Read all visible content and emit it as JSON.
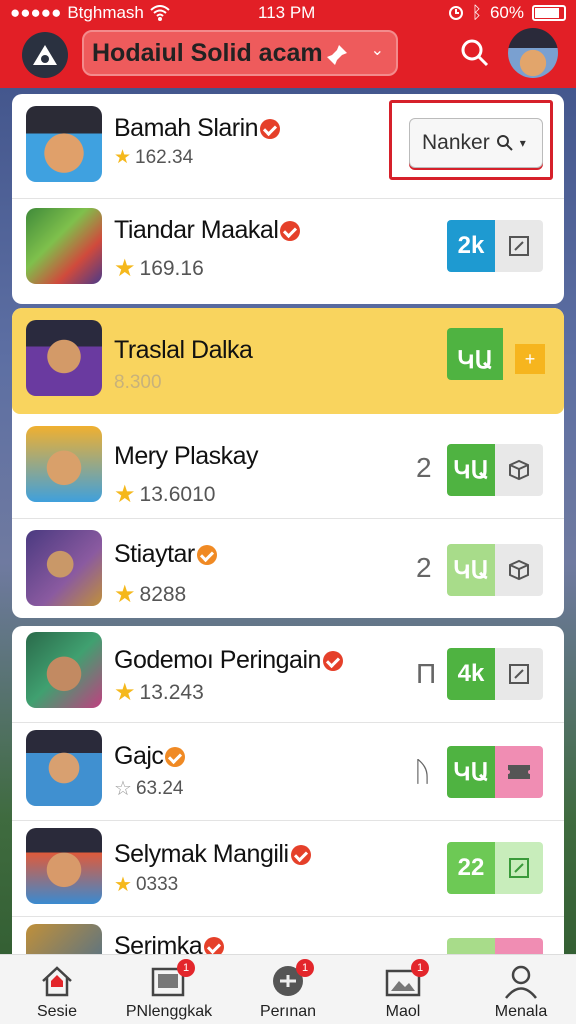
{
  "status": {
    "carrier": "Btghmash",
    "time": "113 PM",
    "battery": "60%"
  },
  "header": {
    "search_value": "Hodaiul Solid acam"
  },
  "featured": {
    "name": "Bamah Slarin",
    "rating": "162.34",
    "filter_value": "Nanker"
  },
  "games": [
    {
      "name": "Tiandar Maakal",
      "rating": "169.16",
      "count": "",
      "action": "2k",
      "accent": "#1e9ad1",
      "second": "edit",
      "second_color": "#e8e8e8"
    },
    {
      "name": "Traslal Dalka",
      "rating": "8.300",
      "count": "",
      "action": "ԿԱ",
      "accent": "#4fb341",
      "second": "+",
      "second_color": "#f6b51e"
    },
    {
      "name": "Mery Plaskay",
      "rating": "13.6010",
      "count": "2",
      "action": "ԿԱ",
      "accent": "#4fb341",
      "second": "box",
      "second_color": "#e8e8e8"
    },
    {
      "name": "Stiaytar",
      "rating": "8288",
      "count": "2",
      "action": "ԿԱ",
      "accent": "#a8dc8a",
      "second": "box",
      "second_color": "#e8e8e8"
    },
    {
      "name": "Godemoı Peringain",
      "rating": "13.243",
      "count": "Π",
      "action": "4k",
      "accent": "#4fb341",
      "second": "edit",
      "second_color": "#e8e8e8"
    },
    {
      "name": "Gajc",
      "rating": "63.24",
      "count": "ᚢ",
      "action": "ԿԱ",
      "accent": "#4fb341",
      "second": "ticket",
      "second_color": "#f08db3"
    },
    {
      "name": "Selymak Mangili",
      "rating": "0333",
      "count": "",
      "action": "22",
      "accent": "#6dc955",
      "second": "edit",
      "second_color": "#c8edbb"
    },
    {
      "name": "Serimka",
      "rating": "",
      "count": "",
      "action": "",
      "accent": "#a8dc8a",
      "second": "",
      "second_color": "#f08db3"
    }
  ],
  "nav": [
    {
      "label": "Sesie",
      "icon": "home-icon",
      "badge": ""
    },
    {
      "label": "PNlenggkak",
      "icon": "gallery-icon",
      "badge": "1"
    },
    {
      "label": "Perınan",
      "icon": "gamepad-icon",
      "badge": "1"
    },
    {
      "label": "Maol",
      "icon": "image-icon",
      "badge": "1"
    },
    {
      "label": "Menala",
      "icon": "user-icon",
      "badge": ""
    }
  ]
}
